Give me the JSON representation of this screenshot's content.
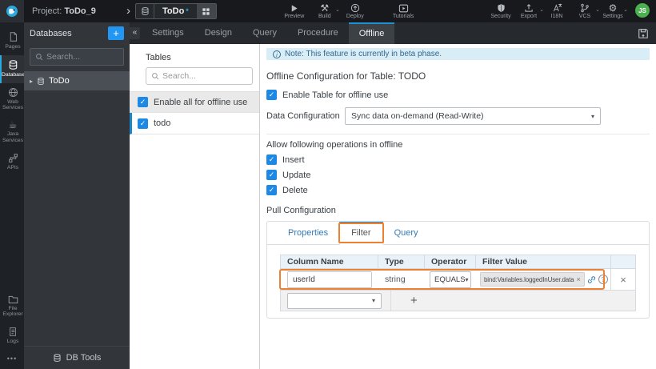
{
  "icons": {
    "caret_down": "▾",
    "caret_small": "⌄",
    "collapse": "«",
    "expand": "▸",
    "close": "×",
    "delete": "×",
    "plus": "+",
    "more": "•••",
    "check": "✓",
    "question": "?",
    "info": "i",
    "crumb": "›",
    "gear": "⚙",
    "build": "⚒",
    "coffee": "☕"
  },
  "topbar": {
    "project_label": "Project:",
    "project_name": "ToDo_9",
    "service_tab": {
      "label": "ToDo",
      "dirty": "*"
    },
    "actions": [
      {
        "label": "Preview"
      },
      {
        "label": "Build"
      },
      {
        "label": "Deploy"
      },
      {
        "label": "Tutorials"
      }
    ],
    "right_actions": [
      {
        "label": "Security"
      },
      {
        "label": "Export"
      },
      {
        "label": "I18N"
      },
      {
        "label": "VCS"
      },
      {
        "label": "Settings"
      }
    ],
    "avatar": "JS"
  },
  "rail": {
    "items": [
      {
        "label": "Pages"
      },
      {
        "label": "Databases",
        "active": true
      },
      {
        "label": "Web Services"
      },
      {
        "label": "Java Services"
      },
      {
        "label": "APIs"
      }
    ],
    "bottom_items": [
      {
        "label": "File Explorer"
      },
      {
        "label": "Logs"
      }
    ]
  },
  "db_panel": {
    "title": "Databases",
    "search_placeholder": "Search...",
    "tree_item": "ToDo",
    "footer": "DB Tools"
  },
  "tables_panel": {
    "title": "Tables",
    "search_placeholder": "Search...",
    "rows": [
      {
        "label": "Enable all for offline use",
        "checked": true
      },
      {
        "label": "todo",
        "checked": true,
        "selected": true
      }
    ]
  },
  "editor_tabs": {
    "items": [
      {
        "label": "Settings"
      },
      {
        "label": "Design"
      },
      {
        "label": "Query"
      },
      {
        "label": "Procedure"
      },
      {
        "label": "Offline",
        "active": true
      }
    ]
  },
  "offline": {
    "note": "Note: This feature is currently in beta phase.",
    "title": "Offline Configuration for Table: TODO",
    "enable_table_label": "Enable Table for offline use",
    "data_configuration_label": "Data Configuration",
    "data_configuration_value": "Sync data on-demand (Read-Write)",
    "operations_heading": "Allow following operations in offline",
    "operations": [
      {
        "label": "Insert",
        "checked": true
      },
      {
        "label": "Update",
        "checked": true
      },
      {
        "label": "Delete",
        "checked": true
      }
    ],
    "pull_heading": "Pull Configuration",
    "pull_tabs": [
      {
        "label": "Properties"
      },
      {
        "label": "Filter",
        "active": true,
        "annotated": true
      },
      {
        "label": "Query"
      }
    ],
    "filter_table": {
      "headers": [
        "Column Name",
        "Type",
        "Operator",
        "Filter Value"
      ],
      "row": {
        "column_name": "userId",
        "type": "string",
        "operator": "EQUALS",
        "filter_value": "bind:Variables.loggedInUser.data"
      }
    }
  },
  "colors": {
    "accent_blue": "#2196f3",
    "wavemaker_blue": "#2aa9e0",
    "active_tab_border": "#1f8fd6",
    "annotation_orange": "#ee8030",
    "avatar_green": "#4caf50",
    "note_bg": "#d9edf7",
    "table_header_bg": "#e9f2f9"
  }
}
